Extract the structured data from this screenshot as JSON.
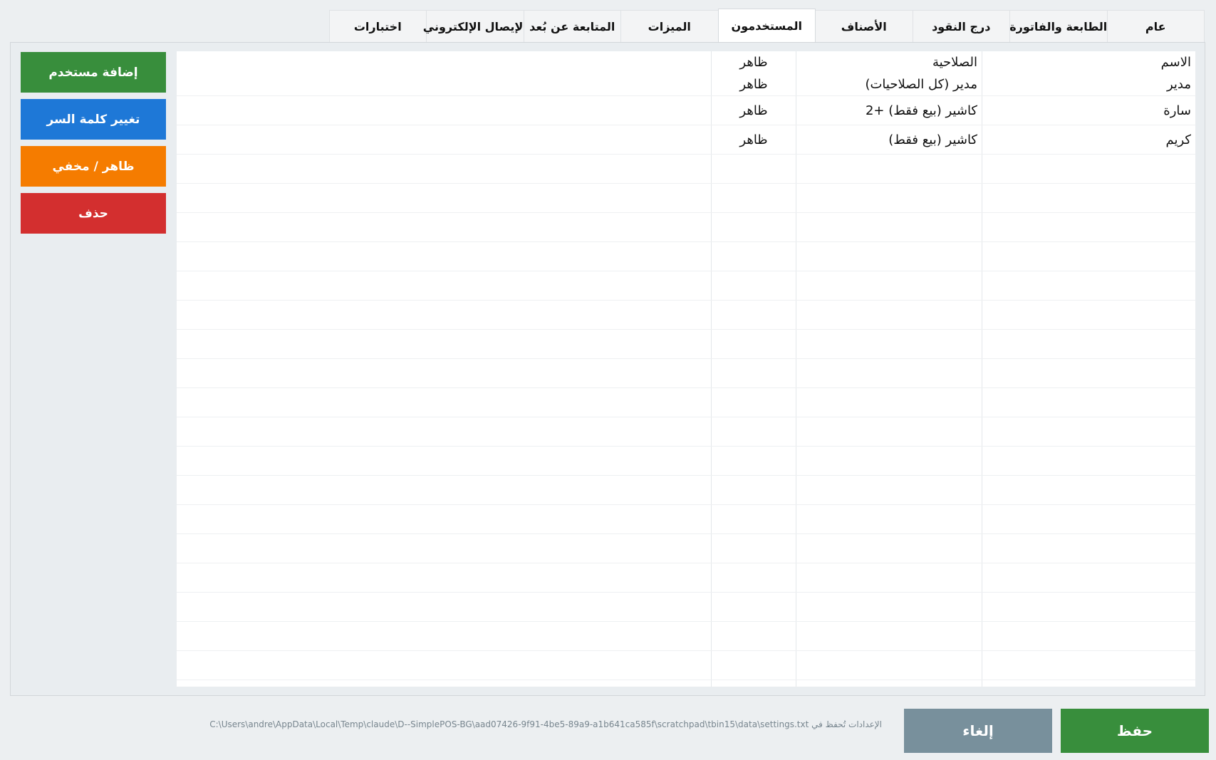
{
  "tabs": [
    {
      "id": "general",
      "label": "عام"
    },
    {
      "id": "printer",
      "label": "الطابعة والفاتورة"
    },
    {
      "id": "drawer",
      "label": "درج النقود"
    },
    {
      "id": "categories",
      "label": "الأصناف"
    },
    {
      "id": "users",
      "label": "المستخدمون",
      "active": true
    },
    {
      "id": "features",
      "label": "الميزات"
    },
    {
      "id": "remote",
      "label": "المتابعة عن بُعد"
    },
    {
      "id": "ereceipt",
      "label": "الإيصال الإلكتروني"
    },
    {
      "id": "tests",
      "label": "اختبارات"
    }
  ],
  "actions": [
    {
      "id": "add-user",
      "label": "إضافة مستخدم",
      "color": "#388e3c"
    },
    {
      "id": "change-password",
      "label": "تغيير كلمة السر",
      "color": "#1e78d7"
    },
    {
      "id": "toggle-visibility",
      "label": "ظاهر / مخفي",
      "color": "#f57c00"
    },
    {
      "id": "delete",
      "label": "حذف",
      "color": "#d32f2f"
    }
  ],
  "grid": {
    "columns": {
      "name": "الاسم",
      "role": "الصلاحية",
      "visibility": ""
    },
    "rows": [
      {
        "name": "مدير",
        "role": "مدير (كل الصلاحيات)",
        "visibility": "ظاهر"
      },
      {
        "name": "سارة",
        "role": "كاشير (بيع فقط)  +2",
        "visibility": "ظاهر"
      },
      {
        "name": "كريم",
        "role": "كاشير (بيع فقط)",
        "visibility": "ظاهر"
      }
    ],
    "header_visibility_value": "ظاهر"
  },
  "footer": {
    "save_label": "حفظ",
    "cancel_label": "إلغاء",
    "settings_path_note": "الإعدادات تُحفظ في C:\\Users\\andre\\AppData\\Local\\Temp\\claude\\D--SimplePOS-BG\\aad07426-9f91-4be5-89a9-a1b641ca585f\\scratchpad\\tbin15\\data\\settings.txt"
  }
}
